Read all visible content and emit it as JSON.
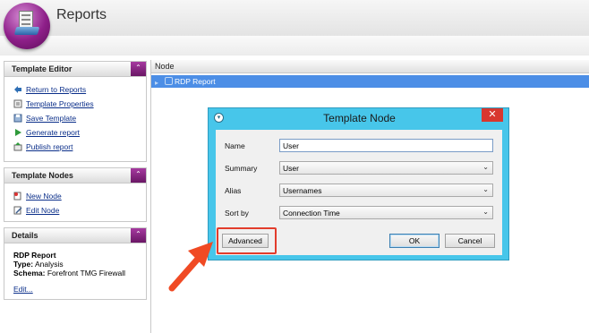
{
  "app": {
    "title": "Reports"
  },
  "sidebar": {
    "template_editor": {
      "title": "Template Editor",
      "collapse_glyph": "⌃",
      "items": [
        {
          "label": "Return to Reports",
          "icon": "back-arrow-icon"
        },
        {
          "label": "Template Properties",
          "icon": "properties-icon"
        },
        {
          "label": "Save Template",
          "icon": "save-icon"
        },
        {
          "label": "Generate report",
          "icon": "play-icon"
        },
        {
          "label": "Publish report",
          "icon": "publish-icon"
        }
      ]
    },
    "template_nodes": {
      "title": "Template Nodes",
      "collapse_glyph": "⌃",
      "items": [
        {
          "label": "New Node",
          "icon": "new-node-icon"
        },
        {
          "label": "Edit Node",
          "icon": "edit-node-icon"
        }
      ]
    },
    "details": {
      "title": "Details",
      "collapse_glyph": "⌃",
      "report_name": "RDP Report",
      "type_label": "Type:",
      "type_value": "Analysis",
      "schema_label": "Schema:",
      "schema_value": "Forefront TMG Firewall",
      "edit_label": "Edit..."
    }
  },
  "grid": {
    "column_header": "Node",
    "rows": [
      {
        "label": "RDP Report",
        "selected": true
      }
    ]
  },
  "dialog": {
    "title": "Template Node",
    "close_glyph": "✕",
    "fields": {
      "name": {
        "label": "Name",
        "value": "User"
      },
      "summary": {
        "label": "Summary",
        "value": "User"
      },
      "alias": {
        "label": "Alias",
        "value": "Usernames"
      },
      "sort_by": {
        "label": "Sort by",
        "value": "Connection Time"
      }
    },
    "buttons": {
      "advanced": "Advanced",
      "ok": "OK",
      "cancel": "Cancel"
    }
  },
  "colors": {
    "accent_purple": "#7a1a75",
    "dialog_frame": "#47c6ea",
    "close_red": "#d8372f",
    "selection_blue": "#4c8ee6",
    "annotation_red": "#e23c2c"
  }
}
